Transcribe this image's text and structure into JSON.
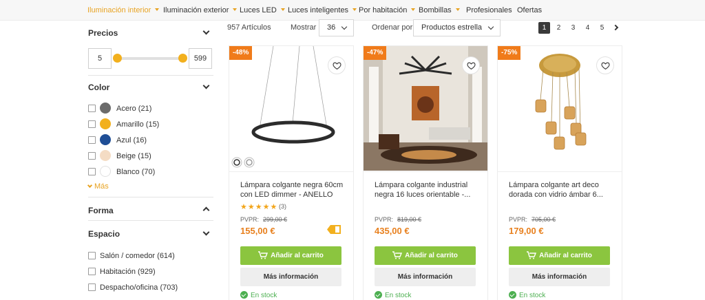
{
  "nav": {
    "items": [
      {
        "label": "Iluminación interior",
        "active": true,
        "has_menu": true
      },
      {
        "label": "Iluminación exterior",
        "active": false,
        "has_menu": true
      },
      {
        "label": "Luces LED",
        "active": false,
        "has_menu": true
      },
      {
        "label": "Luces inteligentes",
        "active": false,
        "has_menu": true
      },
      {
        "label": "Por habitación",
        "active": false,
        "has_menu": true
      },
      {
        "label": "Bombillas",
        "active": false,
        "has_menu": true
      },
      {
        "label": "Profesionales",
        "active": false,
        "has_menu": false
      },
      {
        "label": "Ofertas",
        "active": false,
        "has_menu": false
      }
    ]
  },
  "sidebar": {
    "precios": {
      "title": "Precios",
      "min": "5",
      "max": "599"
    },
    "color": {
      "title": "Color",
      "options": [
        {
          "label": "Acero (21)",
          "swatch": "#6b6b6b"
        },
        {
          "label": "Amarillo (15)",
          "swatch": "#f2b01e"
        },
        {
          "label": "Azul (16)",
          "swatch": "#1f4e96"
        },
        {
          "label": "Beige (15)",
          "swatch": "#f4dcc4"
        },
        {
          "label": "Blanco (70)",
          "swatch": "#ffffff"
        }
      ],
      "more_label": "Más"
    },
    "forma": {
      "title": "Forma"
    },
    "espacio": {
      "title": "Espacio",
      "options": [
        {
          "label": "Salón / comedor (614)"
        },
        {
          "label": "Habitación (929)"
        },
        {
          "label": "Despacho/oficina (703)"
        }
      ]
    }
  },
  "toolbar": {
    "count": "957 Artículos",
    "show_label": "Mostrar",
    "show_value": "36",
    "sort_label": "Ordenar por",
    "sort_value": "Productos estrella",
    "pages": [
      "1",
      "2",
      "3",
      "4",
      "5"
    ],
    "current_page": "1"
  },
  "products": [
    {
      "discount": "-48%",
      "title": "Lámpara colgante negra 60cm con LED dimmer - ANELLO",
      "stars": "★★★★★",
      "reviews": "(3)",
      "pvpr_label": "PVPR:",
      "old_price": "299,00 €",
      "price": "155,00 €",
      "cart_label": "Añadir al carrito",
      "info_label": "Más información",
      "stock": "En stock"
    },
    {
      "discount": "-47%",
      "title": "Lámpara colgante industrial negra 16 luces orientable -...",
      "stars": "",
      "reviews": "",
      "pvpr_label": "PVPR:",
      "old_price": "819,00 €",
      "price": "435,00 €",
      "cart_label": "Añadir al carrito",
      "info_label": "Más información",
      "stock": "En stock"
    },
    {
      "discount": "-75%",
      "title": "Lámpara colgante art deco dorada con vidrio ámbar 6...",
      "stars": "",
      "reviews": "",
      "pvpr_label": "PVPR:",
      "old_price": "705,00 €",
      "price": "179,00 €",
      "cart_label": "Añadir al carrito",
      "info_label": "Más información",
      "stock": "En stock"
    }
  ],
  "colors": {
    "accent": "#e8a322",
    "price": "#e8801e",
    "cart_button": "#8bc53f",
    "discount": "#f07b1a",
    "stock": "#4caf50"
  }
}
